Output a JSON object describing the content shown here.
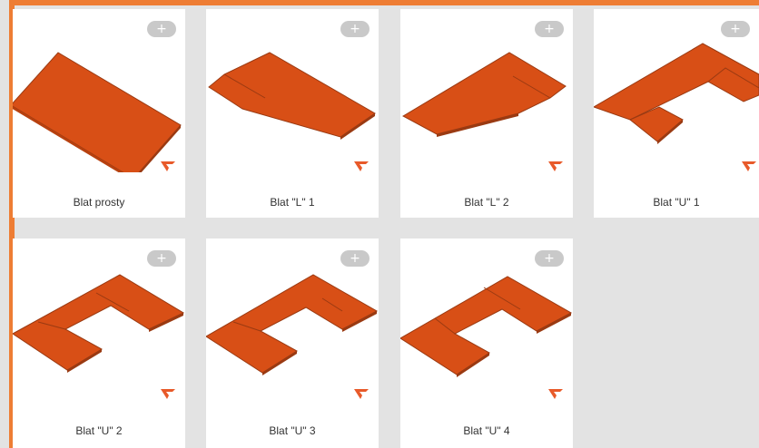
{
  "accent_color": "#ee7d34",
  "top_color": "#d84f16",
  "edge_color": "#9a3a12",
  "add_button_label": "+",
  "brand_icon": "brand-v-logo-icon",
  "cards": [
    {
      "label": "Blat prosty",
      "shape": "straight"
    },
    {
      "label": "Blat \"L\" 1",
      "shape": "l1"
    },
    {
      "label": "Blat \"L\" 2",
      "shape": "l2"
    },
    {
      "label": "Blat \"U\" 1",
      "shape": "u1"
    },
    {
      "label": "Blat \"U\" 2",
      "shape": "u2"
    },
    {
      "label": "Blat \"U\" 3",
      "shape": "u3"
    },
    {
      "label": "Blat \"U\" 4",
      "shape": "u4"
    }
  ]
}
